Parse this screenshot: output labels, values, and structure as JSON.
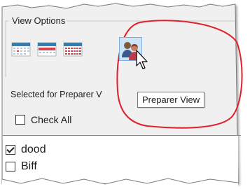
{
  "view_options": {
    "group_label": "View Options",
    "buttons": [
      {
        "name": "calendar-small-view-button",
        "icon": "calendar-small-icon"
      },
      {
        "name": "calendar-wide-view-button",
        "icon": "calendar-wide-icon"
      },
      {
        "name": "calendar-grid-view-button",
        "icon": "calendar-grid-icon"
      },
      {
        "name": "preparer-view-button",
        "icon": "preparer-people-icon",
        "active": true
      }
    ]
  },
  "preparer_section": {
    "label": "Selected for Preparer V",
    "check_all_label": "Check All",
    "check_all_checked": false
  },
  "tooltip": {
    "text": "Preparer View"
  },
  "list": {
    "items": [
      {
        "label": "dood",
        "checked": true
      },
      {
        "label": "Biff",
        "checked": false
      }
    ]
  },
  "colors": {
    "panel_bg": "#f0f0f0",
    "highlight_ellipse": "#e0202a",
    "active_button_bg": "#cde4f7",
    "calendar_header": "#2f7fb8",
    "calendar_red": "#d9414a"
  }
}
